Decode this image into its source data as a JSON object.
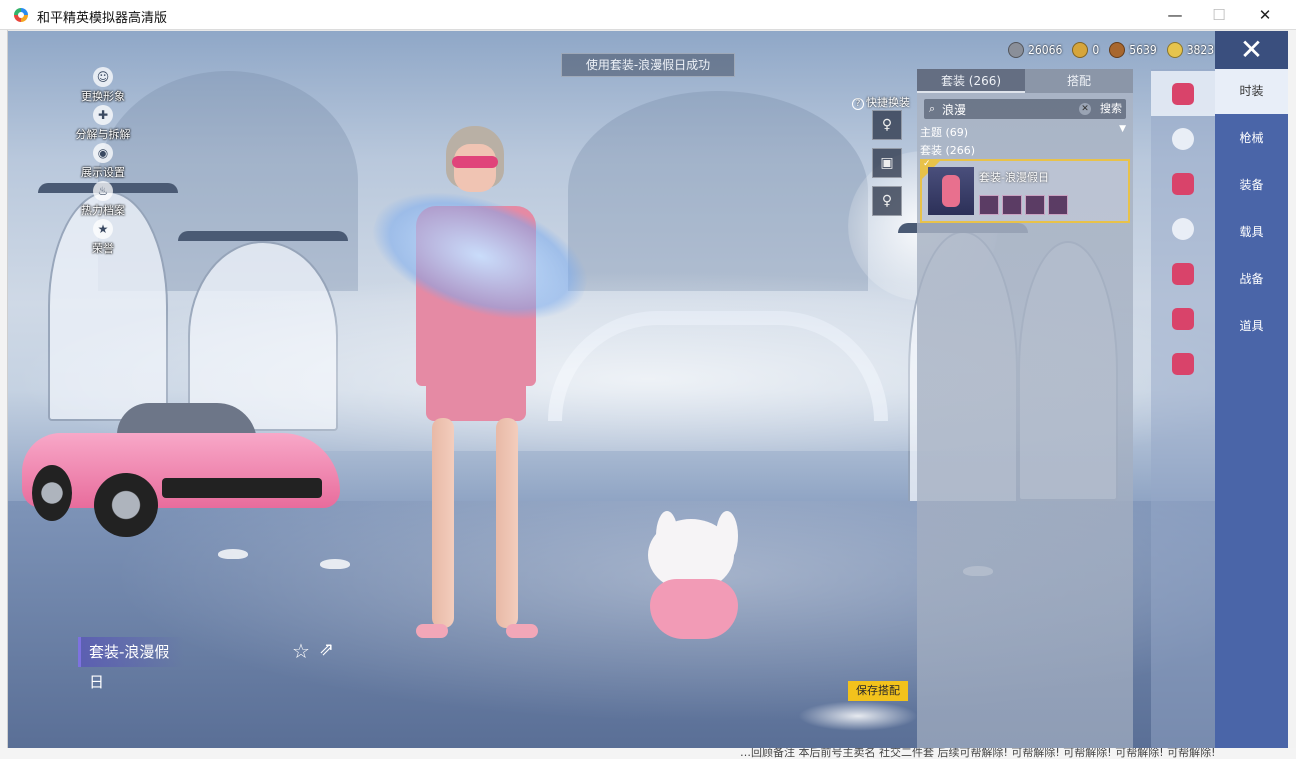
{
  "window": {
    "title": "和平精英模拟器高清版",
    "minimize": "—",
    "maximize": "☐",
    "close": "✕"
  },
  "toast": "使用套装-浪漫假日成功",
  "left_menu": [
    {
      "label": "更换形象",
      "icon": "person-icon"
    },
    {
      "label": "分解与拆解",
      "icon": "puzzle-icon"
    },
    {
      "label": "展示设置",
      "icon": "eye-icon"
    },
    {
      "label": "热力档案",
      "icon": "flame-icon"
    },
    {
      "label": "荣誉",
      "icon": "medal-icon"
    }
  ],
  "currencies": [
    {
      "icon": "silver-coin-icon",
      "value": "26066",
      "color": "#8a8f99"
    },
    {
      "icon": "gold-coin-icon",
      "value": "0",
      "color": "#d6a53a"
    },
    {
      "icon": "bronze-coin-icon",
      "value": "5639",
      "color": "#a8672e"
    },
    {
      "icon": "gem-coin-icon",
      "value": "3823",
      "color": "#e6c44d"
    }
  ],
  "quick_change": {
    "title": "快捷换装",
    "slots": [
      "♀",
      "▣",
      "♀"
    ]
  },
  "panel": {
    "tabs": [
      "套装 (266)",
      "搭配"
    ],
    "search": {
      "value": "浪漫",
      "button": "搜索"
    },
    "theme": "主题 (69)",
    "suit_count": "套装 (266)",
    "result": {
      "name": "套装-浪漫假日",
      "check": "✓"
    }
  },
  "categories": [
    {
      "label": "时装",
      "active": true
    },
    {
      "label": "枪械",
      "active": false
    },
    {
      "label": "装备",
      "active": false
    },
    {
      "label": "载具",
      "active": false
    },
    {
      "label": "战备",
      "active": false
    },
    {
      "label": "道具",
      "active": false
    }
  ],
  "outfit_name": "套装-浪漫假日",
  "save_button": "保存搭配",
  "bottom_text": "…回顾备注     本后前号主卖名 社交二件套 后续可帮解除! 可帮解除! 可帮解除! 可帮解除! 可帮解除!",
  "colors": {
    "accent_blue": "#4a65a8",
    "save_yellow": "#f2c21c",
    "selected_border": "#e8c24a"
  }
}
